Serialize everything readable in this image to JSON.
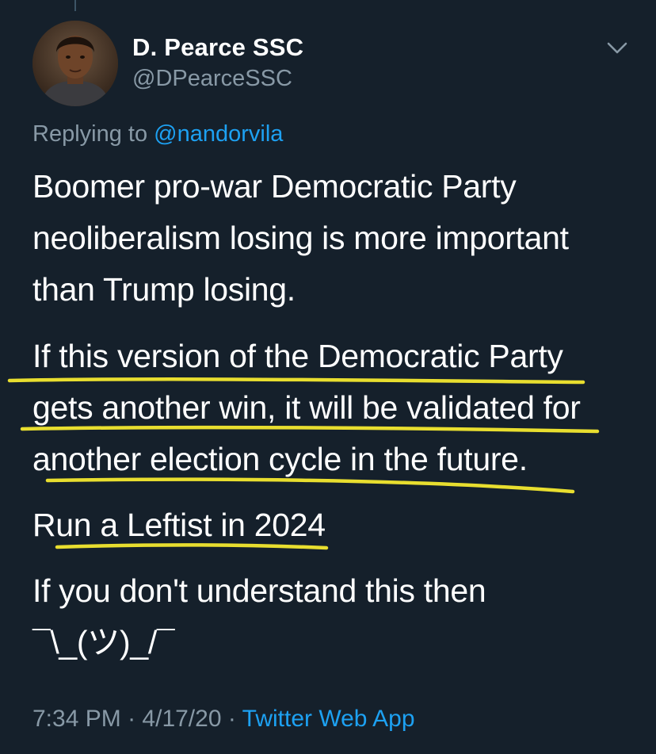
{
  "tweet": {
    "author": {
      "name": "D. Pearce SSC",
      "handle": "@DPearceSSC",
      "avatar_icon": "profile-photo"
    },
    "menu_icon": "chevron-down-icon",
    "reply": {
      "prefix": "Replying to",
      "mention": "@nandorvila"
    },
    "paragraphs": [
      {
        "lines": [
          "Boomer pro-war Democratic Party",
          "neoliberalism losing is more important",
          "than Trump losing."
        ]
      },
      {
        "lines": [
          "If this version of the Democratic Party",
          "gets another win, it will be validated for",
          "another election cycle in the future."
        ]
      },
      {
        "lines": [
          "Run a Leftist in 2024"
        ]
      },
      {
        "lines": [
          "If you don't understand this then",
          "¯\\_(ツ)_/¯"
        ]
      }
    ],
    "meta": {
      "time": "7:34 PM",
      "separator": "·",
      "date": "4/17/20",
      "app": "Twitter Web App"
    }
  },
  "colors": {
    "background": "#15202b",
    "primary_text": "#ffffff",
    "secondary_text": "#8899a6",
    "link": "#1da1f2",
    "highlight_underline": "#e8de2f"
  }
}
